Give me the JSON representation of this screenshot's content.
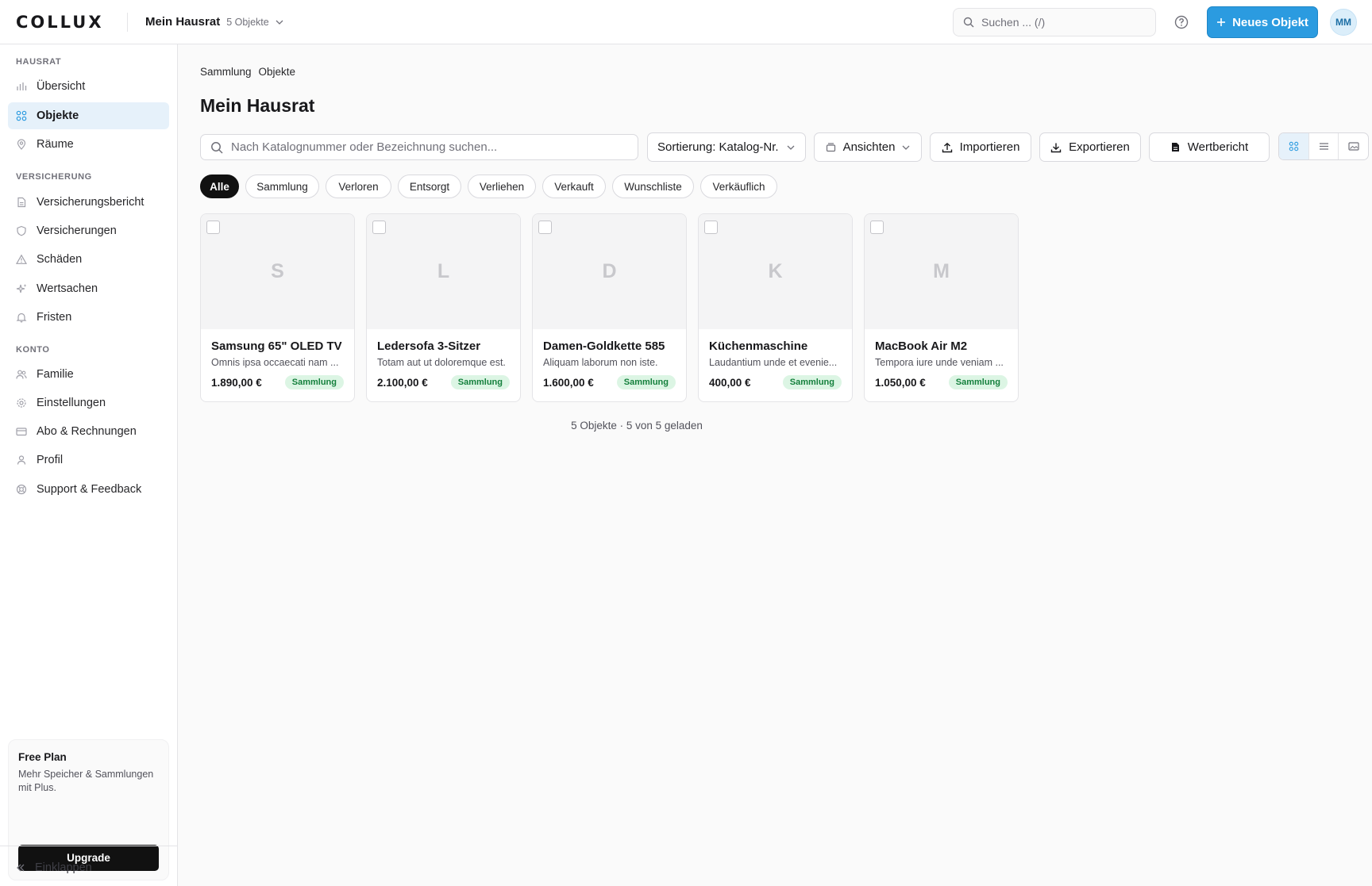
{
  "header": {
    "logo_text": "COLLUX",
    "collection_name": "Mein Hausrat",
    "collection_count": "5 Objekte",
    "search_placeholder": "Suchen ... (/)",
    "new_button_label": "Neues Objekt",
    "avatar_initials": "MM"
  },
  "sidebar": {
    "sections": [
      {
        "title": "Hausrat",
        "items": [
          {
            "label": "Übersicht",
            "icon": "bar-chart-icon"
          },
          {
            "label": "Objekte",
            "icon": "grid-icon",
            "active": true
          },
          {
            "label": "Räume",
            "icon": "map-pin-icon"
          }
        ]
      },
      {
        "title": "Versicherung",
        "items": [
          {
            "label": "Versicherungsbericht",
            "icon": "file-icon"
          },
          {
            "label": "Versicherungen",
            "icon": "shield-icon"
          },
          {
            "label": "Schäden",
            "icon": "warning-icon"
          },
          {
            "label": "Wertsachen",
            "icon": "sparkle-icon"
          },
          {
            "label": "Fristen",
            "icon": "bell-icon"
          }
        ]
      },
      {
        "title": "Konto",
        "items": [
          {
            "label": "Familie",
            "icon": "users-icon"
          },
          {
            "label": "Einstellungen",
            "icon": "gear-icon"
          },
          {
            "label": "Abo & Rechnungen",
            "icon": "credit-card-icon"
          },
          {
            "label": "Profil",
            "icon": "user-icon"
          },
          {
            "label": "Support & Feedback",
            "icon": "lifebuoy-icon"
          }
        ]
      }
    ],
    "plan": {
      "title": "Free Plan",
      "description": "Mehr Speicher & Sammlungen mit Plus.",
      "upgrade_label": "Upgrade"
    },
    "collapse_label": "Einklappen"
  },
  "main": {
    "breadcrumb": [
      "Sammlung",
      "Objekte"
    ],
    "title": "Mein Hausrat",
    "toolbar": {
      "search_placeholder": "Nach Katalognummer oder Bezeichnung suchen...",
      "sort_label": "Sortierung: Katalog-Nr.",
      "views_label": "Ansichten",
      "import_label": "Importieren",
      "export_label": "Exportieren",
      "report_label": "Wertbericht"
    },
    "filters": [
      "Alle",
      "Sammlung",
      "Verloren",
      "Entsorgt",
      "Verliehen",
      "Verkauft",
      "Wunschliste",
      "Verkäuflich"
    ],
    "active_filter": "Alle",
    "items": [
      {
        "initial": "S",
        "title": "Samsung 65\" OLED TV",
        "description": "Omnis ipsa occaecati nam ...",
        "price": "1.890,00 €",
        "status": "Sammlung"
      },
      {
        "initial": "L",
        "title": "Ledersofa 3-Sitzer",
        "description": "Totam aut ut doloremque est.",
        "price": "2.100,00 €",
        "status": "Sammlung"
      },
      {
        "initial": "D",
        "title": "Damen-Goldkette 585",
        "description": "Aliquam laborum non iste.",
        "price": "1.600,00 €",
        "status": "Sammlung"
      },
      {
        "initial": "K",
        "title": "Küchenmaschine",
        "description": "Laudantium unde et evenie...",
        "price": "400,00 €",
        "status": "Sammlung"
      },
      {
        "initial": "M",
        "title": "MacBook Air M2",
        "description": "Tempora iure unde veniam ...",
        "price": "1.050,00 €",
        "status": "Sammlung"
      }
    ],
    "summary": "5 Objekte · 5 von 5 geladen"
  },
  "colors": {
    "accent": "#2b9be0",
    "active_nav_bg": "#e6f1fa",
    "badge_bg": "#dcf5e4",
    "badge_text": "#15803d"
  }
}
